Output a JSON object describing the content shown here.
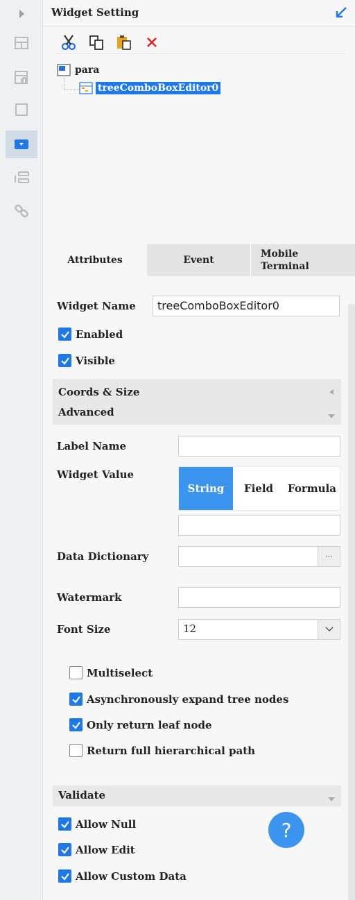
{
  "header": {
    "title": "Widget Setting"
  },
  "tree": {
    "root": "para",
    "child": "treeComboBoxEditor0"
  },
  "tabs": [
    {
      "label": "Attributes"
    },
    {
      "label": "Event"
    },
    {
      "label": "Mobile Terminal"
    }
  ],
  "form": {
    "widget_name_label": "Widget Name",
    "widget_name_value": "treeComboBoxEditor0",
    "enabled": "Enabled",
    "visible": "Visible",
    "coords_size": "Coords & Size",
    "advanced": "Advanced",
    "label_name": "Label Name",
    "widget_value": "Widget Value",
    "value_types": [
      "String",
      "Field",
      "Formula"
    ],
    "data_dictionary": "Data Dictionary",
    "data_dictionary_button": "···",
    "watermark": "Watermark",
    "font_size": "Font Size",
    "font_size_value": "12",
    "multiselect": "Multiselect",
    "async_expand": "Asynchronously expand tree nodes",
    "only_leaf": "Only return leaf node",
    "full_path": "Return full hierarchical path",
    "validate": "Validate",
    "allow_null": "Allow Null",
    "allow_edit": "Allow Edit",
    "allow_custom": "Allow Custom Data",
    "help": "?"
  },
  "checkbox_states": {
    "enabled": true,
    "visible": true,
    "multiselect": false,
    "async_expand": true,
    "only_leaf": true,
    "full_path": false,
    "allow_null": true,
    "allow_edit": true,
    "allow_custom": true
  },
  "colors": {
    "accent": "#1e78e8",
    "button": "#3b95ef",
    "delete": "#e02020"
  }
}
